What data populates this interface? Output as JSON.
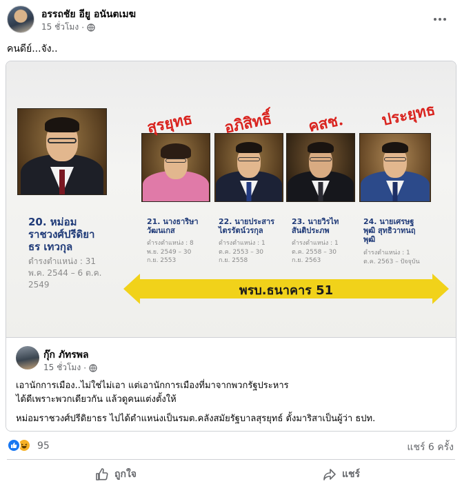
{
  "post": {
    "author": "อรรถชัย อียู อนันตเมฆ",
    "time": "15 ชั่วโมง",
    "dot": "·",
    "caption": "คนดีย์...จัง.."
  },
  "image": {
    "labels": [
      "สุรยุทธ",
      "อภิสิทธิ์",
      "คสช.",
      "ประยุทธ"
    ],
    "people": [
      {
        "name": [
          "20. หม่อม",
          "ราชวงศ์ปรีดิยา",
          "ธร เทวกุล"
        ],
        "term": [
          "ดำรงตำแหน่ง : 31",
          "พ.ค. 2544 – 6 ต.ค.",
          "2549"
        ]
      },
      {
        "name": [
          "21. นางธาริษา",
          "วัฒนเกส"
        ],
        "term": [
          "ดำรงตำแหน่ง : 8",
          "พ.ย. 2549 – 30",
          "ก.ย. 2553"
        ]
      },
      {
        "name": [
          "22. นายประสาร",
          "ไตรรัตน์วรกุล"
        ],
        "term": [
          "ดำรงตำแหน่ง : 1",
          "ต.ค. 2553 – 30",
          "ก.ย. 2558"
        ]
      },
      {
        "name": [
          "23. นายวิรไท",
          "สันติประภพ"
        ],
        "term": [
          "ดำรงตำแหน่ง : 1",
          "ต.ค. 2558 – 30",
          "ก.ย. 2563"
        ]
      },
      {
        "name": [
          "24. นายเศรษฐ",
          "พุฒิ สุทธิวาทนฤ",
          "พุฒิ"
        ],
        "term": [
          "ดำรงตำแหน่ง : 1",
          "ต.ค. 2563 – ปัจจุบัน"
        ]
      }
    ],
    "arrow_text": "พรบ.ธนาคาร 51"
  },
  "comment": {
    "author": "กุ๊ก ภัทรพล",
    "time": "15 ชั่วโมง",
    "dot": "·",
    "lines": [
      "เอานักการเมือง..ไม่ใช่ไม่เอา แต่เอานักการเมืองที่มาจากพวกรัฐประหาร",
      "ได้ดีเพราะพวกเดียวกัน แล้วดูคนแต่งตั้งให้",
      "หม่อมราชวงศ์ปรีดิยาธร ไปได้ตำแหน่งเป็นรมต.คลังสมัยรัฐบาลสุรยุทธ์ ตั้งมาริสาเป็นผู้ว่า ธปท."
    ]
  },
  "stats": {
    "reaction_count": "95",
    "shares": "แชร์ 6 ครั้ง"
  },
  "actions": {
    "like": "ถูกใจ",
    "share": "แชร์"
  },
  "colors": {
    "label_red": "#d9231e",
    "name_blue": "#1f3a78",
    "arrow_yellow": "#f1d21a",
    "fb_blue": "#1877f2",
    "muted": "#65676b"
  },
  "icons": [
    "globe-icon",
    "more-icon",
    "like-icon",
    "haha-icon",
    "thumbs-up-icon",
    "share-icon"
  ]
}
